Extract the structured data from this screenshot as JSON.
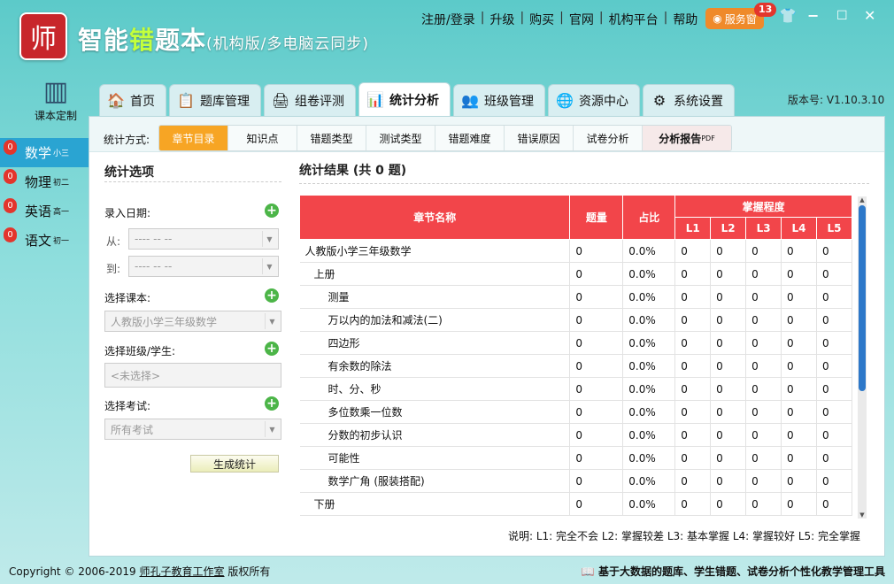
{
  "header": {
    "logo_char": "师",
    "title_a": "智能",
    "title_hl": "错",
    "title_b": "题本",
    "title_sub": "(机构版/多电脑云同步)",
    "menu": [
      "注册/登录",
      "升级",
      "购买",
      "官网",
      "机构平台",
      "帮助"
    ],
    "service_label": "服务窗",
    "service_badge": "13",
    "version": "版本号: V1.10.3.10"
  },
  "left": {
    "custom_label": "课本定制",
    "subjects": [
      {
        "name": "数学",
        "grade": "小三",
        "count": "0"
      },
      {
        "name": "物理",
        "grade": "初二",
        "count": "0"
      },
      {
        "name": "英语",
        "grade": "高一",
        "count": "0"
      },
      {
        "name": "语文",
        "grade": "初一",
        "count": "0"
      }
    ]
  },
  "tabs": [
    {
      "label": "首页",
      "icon": "🏠"
    },
    {
      "label": "题库管理",
      "icon": "📋"
    },
    {
      "label": "组卷评测",
      "icon": "🖨"
    },
    {
      "label": "统计分析",
      "icon": "📊"
    },
    {
      "label": "班级管理",
      "icon": "👥"
    },
    {
      "label": "资源中心",
      "icon": "🌐"
    },
    {
      "label": "系统设置",
      "icon": "⚙"
    }
  ],
  "subnav": {
    "label": "统计方式:",
    "tabs": [
      "章节目录",
      "知识点",
      "错题类型",
      "测试类型",
      "错题难度",
      "错误原因",
      "试卷分析"
    ],
    "pdf_label": "分析报告",
    "pdf_sup": "PDF"
  },
  "options": {
    "title": "统计选项",
    "date_label": "录入日期:",
    "from_label": "从:",
    "to_label": "到:",
    "date_placeholder": "----  --  --",
    "book_label": "选择课本:",
    "book_value": "人教版小学三年级数学",
    "class_label": "选择班级/学生:",
    "class_value": "<未选择>",
    "exam_label": "选择考试:",
    "exam_value": "所有考试",
    "gen_button": "生成统计"
  },
  "results": {
    "title": "统计结果 (共 ",
    "count": "0",
    "title_end": " 题)",
    "headers": {
      "name": "章节名称",
      "qty": "题量",
      "ratio": "占比",
      "mastery": "掌握程度",
      "levels": [
        "L1",
        "L2",
        "L3",
        "L4",
        "L5"
      ]
    },
    "rows": [
      {
        "name": "人教版小学三年级数学",
        "indent": 0,
        "qty": "0",
        "ratio": "0.0%",
        "l": [
          "0",
          "0",
          "0",
          "0",
          "0"
        ]
      },
      {
        "name": "上册",
        "indent": 1,
        "qty": "0",
        "ratio": "0.0%",
        "l": [
          "0",
          "0",
          "0",
          "0",
          "0"
        ]
      },
      {
        "name": "测量",
        "indent": 2,
        "qty": "0",
        "ratio": "0.0%",
        "l": [
          "0",
          "0",
          "0",
          "0",
          "0"
        ]
      },
      {
        "name": "万以内的加法和减法(二)",
        "indent": 2,
        "qty": "0",
        "ratio": "0.0%",
        "l": [
          "0",
          "0",
          "0",
          "0",
          "0"
        ]
      },
      {
        "name": "四边形",
        "indent": 2,
        "qty": "0",
        "ratio": "0.0%",
        "l": [
          "0",
          "0",
          "0",
          "0",
          "0"
        ]
      },
      {
        "name": "有余数的除法",
        "indent": 2,
        "qty": "0",
        "ratio": "0.0%",
        "l": [
          "0",
          "0",
          "0",
          "0",
          "0"
        ]
      },
      {
        "name": "时、分、秒",
        "indent": 2,
        "qty": "0",
        "ratio": "0.0%",
        "l": [
          "0",
          "0",
          "0",
          "0",
          "0"
        ]
      },
      {
        "name": "多位数乘一位数",
        "indent": 2,
        "qty": "0",
        "ratio": "0.0%",
        "l": [
          "0",
          "0",
          "0",
          "0",
          "0"
        ]
      },
      {
        "name": "分数的初步认识",
        "indent": 2,
        "qty": "0",
        "ratio": "0.0%",
        "l": [
          "0",
          "0",
          "0",
          "0",
          "0"
        ]
      },
      {
        "name": "可能性",
        "indent": 2,
        "qty": "0",
        "ratio": "0.0%",
        "l": [
          "0",
          "0",
          "0",
          "0",
          "0"
        ]
      },
      {
        "name": "数学广角 (服装搭配)",
        "indent": 2,
        "qty": "0",
        "ratio": "0.0%",
        "l": [
          "0",
          "0",
          "0",
          "0",
          "0"
        ]
      },
      {
        "name": "下册",
        "indent": 1,
        "qty": "0",
        "ratio": "0.0%",
        "l": [
          "0",
          "0",
          "0",
          "0",
          "0"
        ]
      }
    ],
    "note": "说明: L1: 完全不会  L2: 掌握较差  L3: 基本掌握  L4: 掌握较好  L5: 完全掌握"
  },
  "footer": {
    "copy_a": "Copyright © 2006-2019 ",
    "copy_link": "师孔子教育工作室",
    "copy_b": " 版权所有",
    "slogan": "基于大数据的题库、学生错题、试卷分析个性化教学管理工具"
  }
}
